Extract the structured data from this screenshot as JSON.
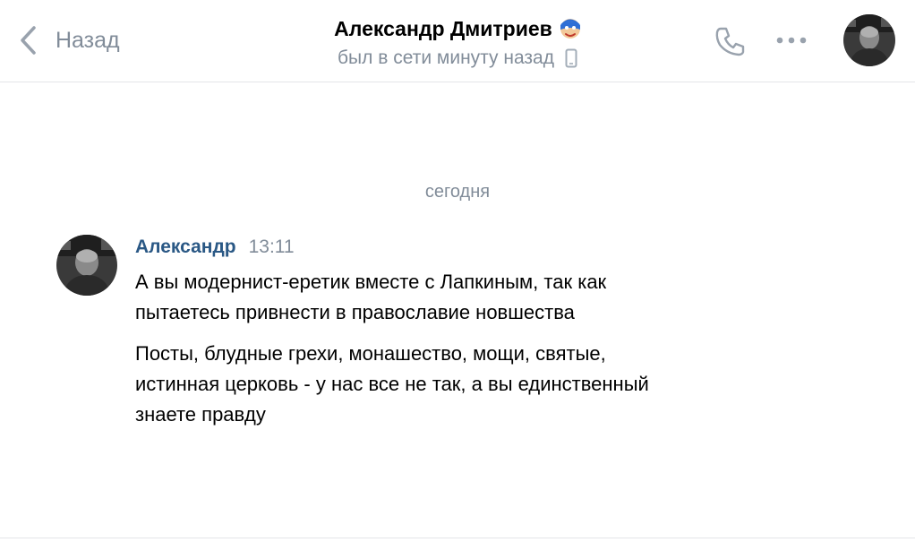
{
  "header": {
    "back_label": "Назад",
    "title": "Александр Дмитриев",
    "title_emoji": "superhero-mask-emoji",
    "status": "был в сети минуту назад",
    "status_icon": "mobile-phone-icon",
    "call_icon": "phone-call-icon",
    "more_icon": "more-dots-icon"
  },
  "chat": {
    "date_separator": "сегодня",
    "messages": [
      {
        "author": "Александр",
        "time": "13:11",
        "paragraphs": [
          "А вы модернист-еретик вместе с Лапкиным, так как\nпытаетесь привнести в православие новшества",
          "Посты, блудные грехи, монашество, мощи, святые,\nистинная церковь - у нас все не так, а вы единственный\nзнаете правду"
        ]
      }
    ]
  },
  "colors": {
    "accent_link": "#2a5885",
    "secondary_text": "#818c99",
    "divider": "#e3e5e8",
    "background": "#ffffff"
  }
}
